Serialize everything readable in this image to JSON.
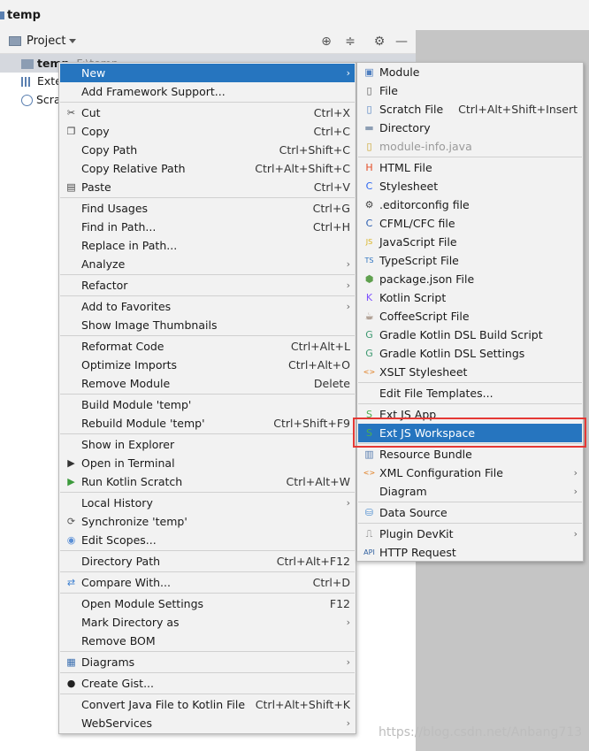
{
  "window": {
    "title": "temp"
  },
  "project_panel": {
    "label": "Project",
    "tree": [
      {
        "label": "temp",
        "suffix": "F:\\temp"
      },
      {
        "label": "Exte"
      },
      {
        "label": "Scra"
      }
    ]
  },
  "context_menu": {
    "items": [
      {
        "label": "New",
        "arrow": "›",
        "icon": ""
      },
      {
        "label": "Add Framework Support...",
        "icon": ""
      },
      {
        "label": "Cut",
        "shortcut": "Ctrl+X",
        "icon": "scissors-icon"
      },
      {
        "label": "Copy",
        "shortcut": "Ctrl+C",
        "icon": "copy-icon"
      },
      {
        "label": "Copy Path",
        "shortcut": "Ctrl+Shift+C",
        "icon": ""
      },
      {
        "label": "Copy Relative Path",
        "shortcut": "Ctrl+Alt+Shift+C",
        "icon": ""
      },
      {
        "label": "Paste",
        "shortcut": "Ctrl+V",
        "icon": "paste-icon"
      },
      {
        "label": "Find Usages",
        "shortcut": "Ctrl+G",
        "icon": ""
      },
      {
        "label": "Find in Path...",
        "shortcut": "Ctrl+H",
        "icon": ""
      },
      {
        "label": "Replace in Path...",
        "icon": ""
      },
      {
        "label": "Analyze",
        "arrow": "›",
        "icon": ""
      },
      {
        "label": "Refactor",
        "arrow": "›",
        "icon": ""
      },
      {
        "label": "Add to Favorites",
        "arrow": "›",
        "icon": ""
      },
      {
        "label": "Show Image Thumbnails",
        "icon": ""
      },
      {
        "label": "Reformat Code",
        "shortcut": "Ctrl+Alt+L",
        "icon": ""
      },
      {
        "label": "Optimize Imports",
        "shortcut": "Ctrl+Alt+O",
        "icon": ""
      },
      {
        "label": "Remove Module",
        "shortcut": "Delete",
        "icon": ""
      },
      {
        "label": "Build Module 'temp'",
        "icon": ""
      },
      {
        "label": "Rebuild Module 'temp'",
        "shortcut": "Ctrl+Shift+F9",
        "icon": ""
      },
      {
        "label": "Show in Explorer",
        "icon": ""
      },
      {
        "label": "Open in Terminal",
        "icon": "terminal-icon"
      },
      {
        "label": "Run Kotlin Scratch",
        "shortcut": "Ctrl+Alt+W",
        "icon": "run-icon"
      },
      {
        "label": "Local History",
        "arrow": "›",
        "icon": ""
      },
      {
        "label": "Synchronize 'temp'",
        "icon": "sync-icon"
      },
      {
        "label": "Edit Scopes...",
        "icon": "scope-icon"
      },
      {
        "label": "Directory Path",
        "shortcut": "Ctrl+Alt+F12",
        "icon": ""
      },
      {
        "label": "Compare With...",
        "shortcut": "Ctrl+D",
        "icon": "compare-icon"
      },
      {
        "label": "Open Module Settings",
        "shortcut": "F12",
        "icon": ""
      },
      {
        "label": "Mark Directory as",
        "arrow": "›",
        "icon": ""
      },
      {
        "label": "Remove BOM",
        "icon": ""
      },
      {
        "label": "Diagrams",
        "arrow": "›",
        "icon": "diagram-icon"
      },
      {
        "label": "Create Gist...",
        "icon": "github-icon"
      },
      {
        "label": "Convert Java File to Kotlin File",
        "shortcut": "Ctrl+Alt+Shift+K",
        "icon": ""
      },
      {
        "label": "WebServices",
        "arrow": "›",
        "icon": ""
      }
    ]
  },
  "new_submenu": {
    "items": [
      {
        "label": "Module",
        "icon": "module-icon"
      },
      {
        "label": "File",
        "icon": "file-icon"
      },
      {
        "label": "Scratch File",
        "shortcut": "Ctrl+Alt+Shift+Insert",
        "icon": "scratch-file-icon"
      },
      {
        "label": "Directory",
        "icon": "folder-icon"
      },
      {
        "label": "module-info.java",
        "icon": "java-file-icon"
      },
      {
        "label": "HTML File",
        "icon": "html-file-icon"
      },
      {
        "label": "Stylesheet",
        "icon": "css-file-icon"
      },
      {
        "label": ".editorconfig file",
        "icon": "editorconfig-icon"
      },
      {
        "label": "CFML/CFC file",
        "icon": "cfml-icon"
      },
      {
        "label": "JavaScript File",
        "icon": "js-file-icon"
      },
      {
        "label": "TypeScript File",
        "icon": "ts-file-icon"
      },
      {
        "label": "package.json File",
        "icon": "nodejs-icon"
      },
      {
        "label": "Kotlin Script",
        "icon": "kotlin-icon"
      },
      {
        "label": "CoffeeScript File",
        "icon": "coffeescript-icon"
      },
      {
        "label": "Gradle Kotlin DSL Build Script",
        "icon": "gradle-icon"
      },
      {
        "label": "Gradle Kotlin DSL Settings",
        "icon": "gradle-icon"
      },
      {
        "label": "XSLT Stylesheet",
        "icon": "xslt-icon"
      },
      {
        "label": "Edit File Templates...",
        "icon": ""
      },
      {
        "label": "Ext JS App",
        "icon": "extjs-icon"
      },
      {
        "label": "Ext JS Workspace",
        "icon": "extjs-icon"
      },
      {
        "label": "Resource Bundle",
        "icon": "resource-bundle-icon"
      },
      {
        "label": "XML Configuration File",
        "arrow": "›",
        "icon": "xml-icon"
      },
      {
        "label": "Diagram",
        "arrow": "›",
        "icon": ""
      },
      {
        "label": "Data Source",
        "icon": "database-icon"
      },
      {
        "label": "Plugin DevKit",
        "arrow": "›",
        "icon": "plugin-icon"
      },
      {
        "label": "HTTP Request",
        "icon": "api-icon"
      }
    ]
  },
  "watermark": "https://blog.csdn.net/Anbang713"
}
